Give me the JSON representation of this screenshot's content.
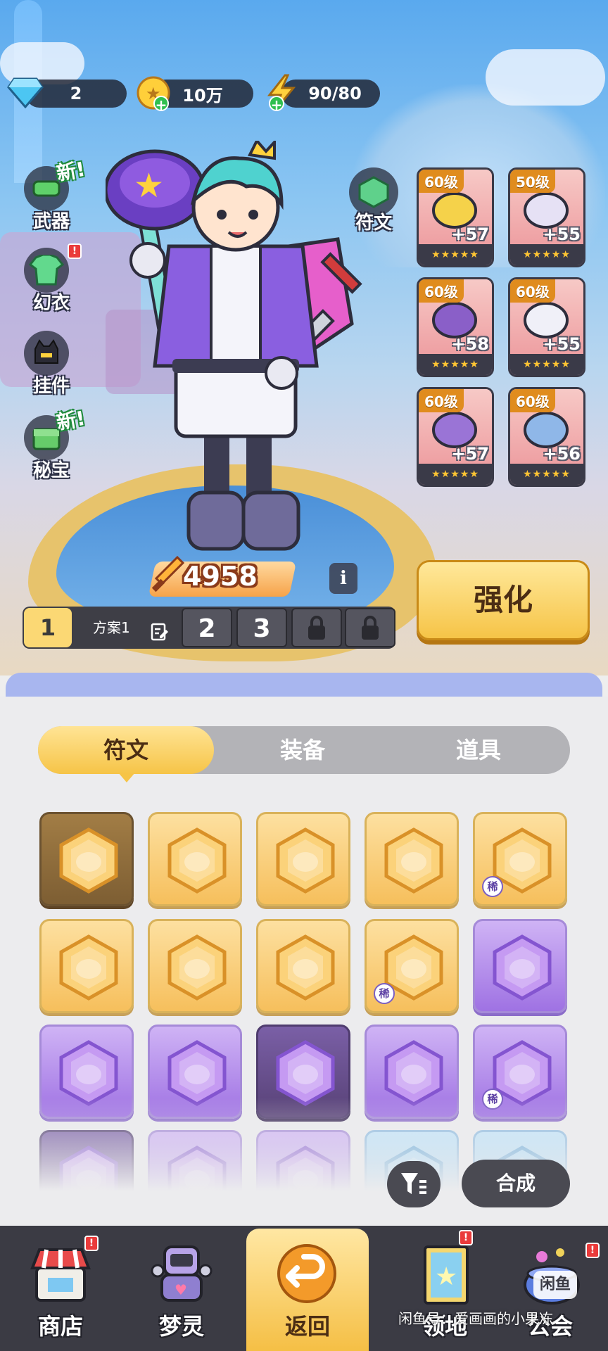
{
  "resources": {
    "gems": "2",
    "coins": "10万",
    "energy": "90/80"
  },
  "side_menu": {
    "weapon": "武器",
    "costume": "幻衣",
    "pendant": "挂件",
    "treasure": "秘宝",
    "new_tag": "新!",
    "alert": "!"
  },
  "rune_button": "符文",
  "equipment": [
    {
      "level": "60级",
      "plus": "+57",
      "stars": "★★★★★"
    },
    {
      "level": "50级",
      "plus": "+55",
      "stars": "★★★★★"
    },
    {
      "level": "60级",
      "plus": "+58",
      "stars": "★★★★★"
    },
    {
      "level": "60级",
      "plus": "+55",
      "stars": "★★★★★"
    },
    {
      "level": "60级",
      "plus": "+57",
      "stars": "★★★★★"
    },
    {
      "level": "60级",
      "plus": "+56",
      "stars": "★★★★★"
    }
  ],
  "power": "4958",
  "info_icon": "i",
  "presets": {
    "active": "1",
    "name": "方案1",
    "slot2": "2",
    "slot3": "3"
  },
  "enhance_label": "强化",
  "tabs": [
    "符文",
    "装备",
    "道具"
  ],
  "rare_badge": "稀",
  "merge_label": "合成",
  "nav": {
    "shop": "商店",
    "dream_spirit": "梦灵",
    "back": "返回",
    "collection": "领地",
    "guild": "公会"
  },
  "watermark": "闲鱼号：爱画画的小果冻",
  "watermark_logo": "闲鱼",
  "colors": {
    "accent_yellow": "#f6c447",
    "dark_panel": "#3b3b44",
    "rune_gold": "#f6bf5c",
    "rune_purple": "#9f72e3",
    "rune_blue": "#84c6f0"
  }
}
